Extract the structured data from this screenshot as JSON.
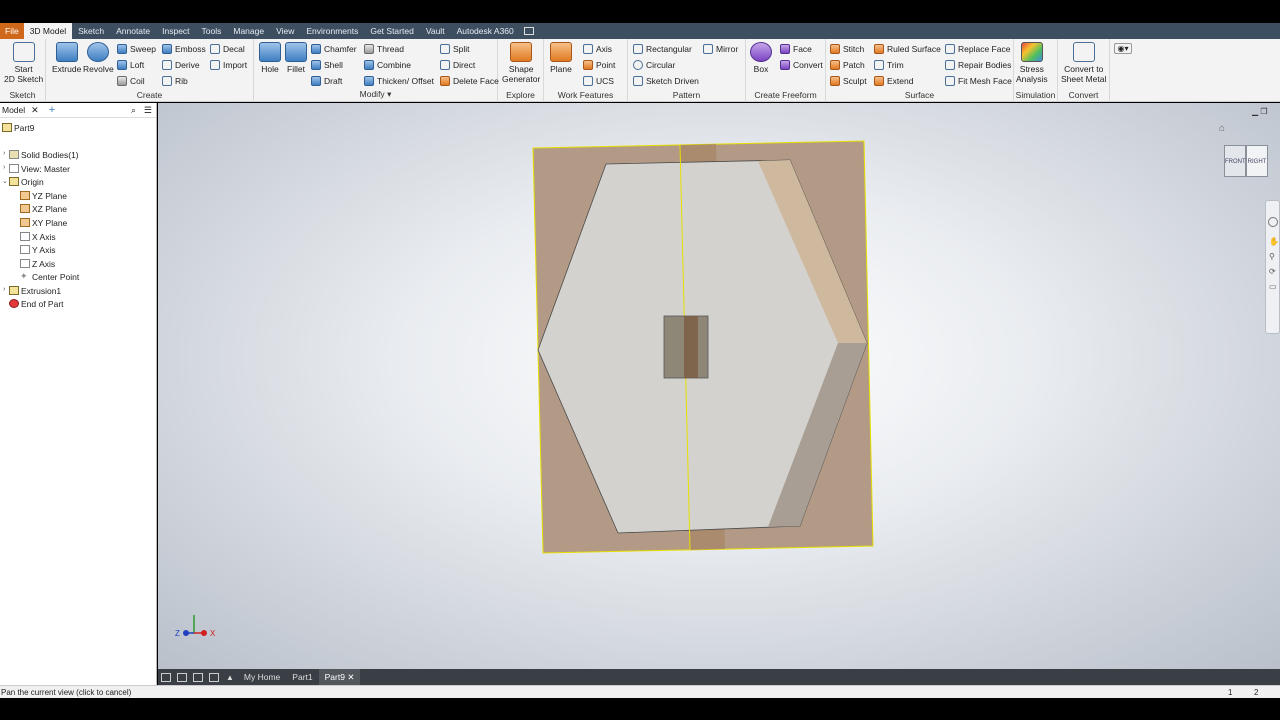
{
  "menu": {
    "tabs": [
      "File",
      "3D Model",
      "Sketch",
      "Annotate",
      "Inspect",
      "Tools",
      "Manage",
      "View",
      "Environments",
      "Get Started",
      "Vault",
      "Autodesk A360"
    ],
    "active_index": 1
  },
  "ribbon": {
    "sketch": {
      "title": "Sketch",
      "start_line1": "Start",
      "start_line2": "2D Sketch"
    },
    "create": {
      "title": "Create",
      "extrude": "Extrude",
      "revolve": "Revolve",
      "sweep": "Sweep",
      "emboss": "Emboss",
      "decal": "Decal",
      "loft": "Loft",
      "derive": "Derive",
      "import": "Import",
      "coil": "Coil",
      "rib": "Rib"
    },
    "modify": {
      "title": "Modify",
      "hole": "Hole",
      "fillet": "Fillet",
      "chamfer": "Chamfer",
      "thread": "Thread",
      "split": "Split",
      "shell": "Shell",
      "combine": "Combine",
      "direct": "Direct",
      "draft": "Draft",
      "thicken": "Thicken/ Offset",
      "delete_face": "Delete Face"
    },
    "explore": {
      "title": "Explore",
      "shape_gen_line1": "Shape",
      "shape_gen_line2": "Generator"
    },
    "work_features": {
      "title": "Work Features",
      "plane": "Plane",
      "axis": "Axis",
      "point": "Point",
      "ucs": "UCS"
    },
    "pattern": {
      "title": "Pattern",
      "rectangular": "Rectangular",
      "mirror": "Mirror",
      "circular": "Circular",
      "sketch_driven": "Sketch Driven"
    },
    "create_freeform": {
      "title": "Create Freeform",
      "box": "Box",
      "face": "Face",
      "convert": "Convert"
    },
    "surface": {
      "title": "Surface",
      "stitch": "Stitch",
      "ruled_surface": "Ruled Surface",
      "replace_face": "Replace Face",
      "patch": "Patch",
      "trim": "Trim",
      "repair_bodies": "Repair Bodies",
      "sculpt": "Sculpt",
      "extend": "Extend",
      "fit_mesh_face": "Fit Mesh Face"
    },
    "simulation": {
      "title": "Simulation",
      "stress_line1": "Stress",
      "stress_line2": "Analysis"
    },
    "convert": {
      "title": "Convert",
      "sheet_line1": "Convert to",
      "sheet_line2": "Sheet Metal"
    }
  },
  "browser": {
    "tab_label": "Model",
    "items": [
      {
        "label": "Part9",
        "kind": "part"
      },
      {
        "label": "Solid Bodies(1)",
        "kind": "solid"
      },
      {
        "label": "View: Master",
        "kind": "view"
      },
      {
        "label": "Origin",
        "kind": "folder"
      },
      {
        "label": "YZ Plane",
        "kind": "plane"
      },
      {
        "label": "XZ Plane",
        "kind": "plane"
      },
      {
        "label": "XY Plane",
        "kind": "plane"
      },
      {
        "label": "X Axis",
        "kind": "axis"
      },
      {
        "label": "Y Axis",
        "kind": "axis"
      },
      {
        "label": "Z Axis",
        "kind": "axis"
      },
      {
        "label": "Center Point",
        "kind": "point"
      },
      {
        "label": "Extrusion1",
        "kind": "feature"
      },
      {
        "label": "End of Part",
        "kind": "end"
      }
    ]
  },
  "viewcube": {
    "front": "FRONT",
    "right": "RIGHT"
  },
  "triad": {
    "z": "Z",
    "x": "X"
  },
  "doc_tabs": [
    "My Home",
    "Part1",
    "Part9"
  ],
  "doc_tabs_active": 2,
  "status": {
    "message": "Pan the current view (click to cancel)",
    "n1": "1",
    "n2": "2"
  },
  "colors": {
    "accent_file": "#d0681c",
    "menubar": "#3c4e60",
    "selection": "#f5f000"
  }
}
